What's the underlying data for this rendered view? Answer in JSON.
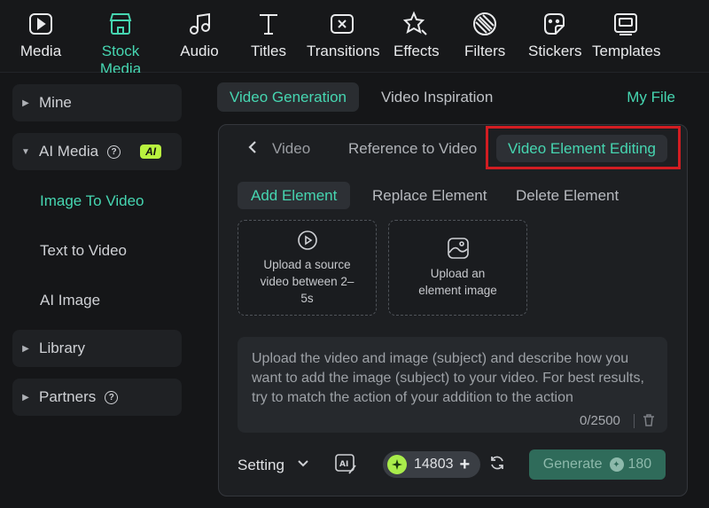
{
  "toolbar": {
    "items": [
      {
        "label": "Media",
        "icon": "media-icon"
      },
      {
        "label": "Stock Media",
        "icon": "stock-media-icon"
      },
      {
        "label": "Audio",
        "icon": "audio-icon"
      },
      {
        "label": "Titles",
        "icon": "titles-icon"
      },
      {
        "label": "Transitions",
        "icon": "transitions-icon"
      },
      {
        "label": "Effects",
        "icon": "effects-icon"
      },
      {
        "label": "Filters",
        "icon": "filters-icon"
      },
      {
        "label": "Stickers",
        "icon": "stickers-icon"
      },
      {
        "label": "Templates",
        "icon": "templates-icon"
      }
    ],
    "active": "Stock Media"
  },
  "sidebar": {
    "mine": "Mine",
    "ai_media": "AI Media",
    "ai_badge": "AI",
    "image_to_video": "Image To Video",
    "text_to_video": "Text to Video",
    "ai_image": "AI Image",
    "library": "Library",
    "partners": "Partners"
  },
  "main": {
    "tab_video_generation": "Video Generation",
    "tab_video_inspiration": "Video Inspiration",
    "my_file": "My File",
    "subtab_video": "Video",
    "subtab_reference": "Reference to Video",
    "subtab_element_editing": "Video Element Editing",
    "etab_add": "Add Element",
    "etab_replace": "Replace Element",
    "etab_delete": "Delete Element",
    "upload_video": "Upload a source video between 2–5s",
    "upload_image": "Upload an element image",
    "description": "Upload the video and image (subject) and describe how you want to add the image (subject) to your video. For best results, try to match the action of your addition to the action",
    "counter": "0/2500",
    "setting": "Setting",
    "credits": "14803",
    "generate": "Generate",
    "generate_cost": "180"
  },
  "colors": {
    "accent": "#46d6b1",
    "highlight": "#d21d22",
    "ai_badge": "#b9f23f"
  }
}
